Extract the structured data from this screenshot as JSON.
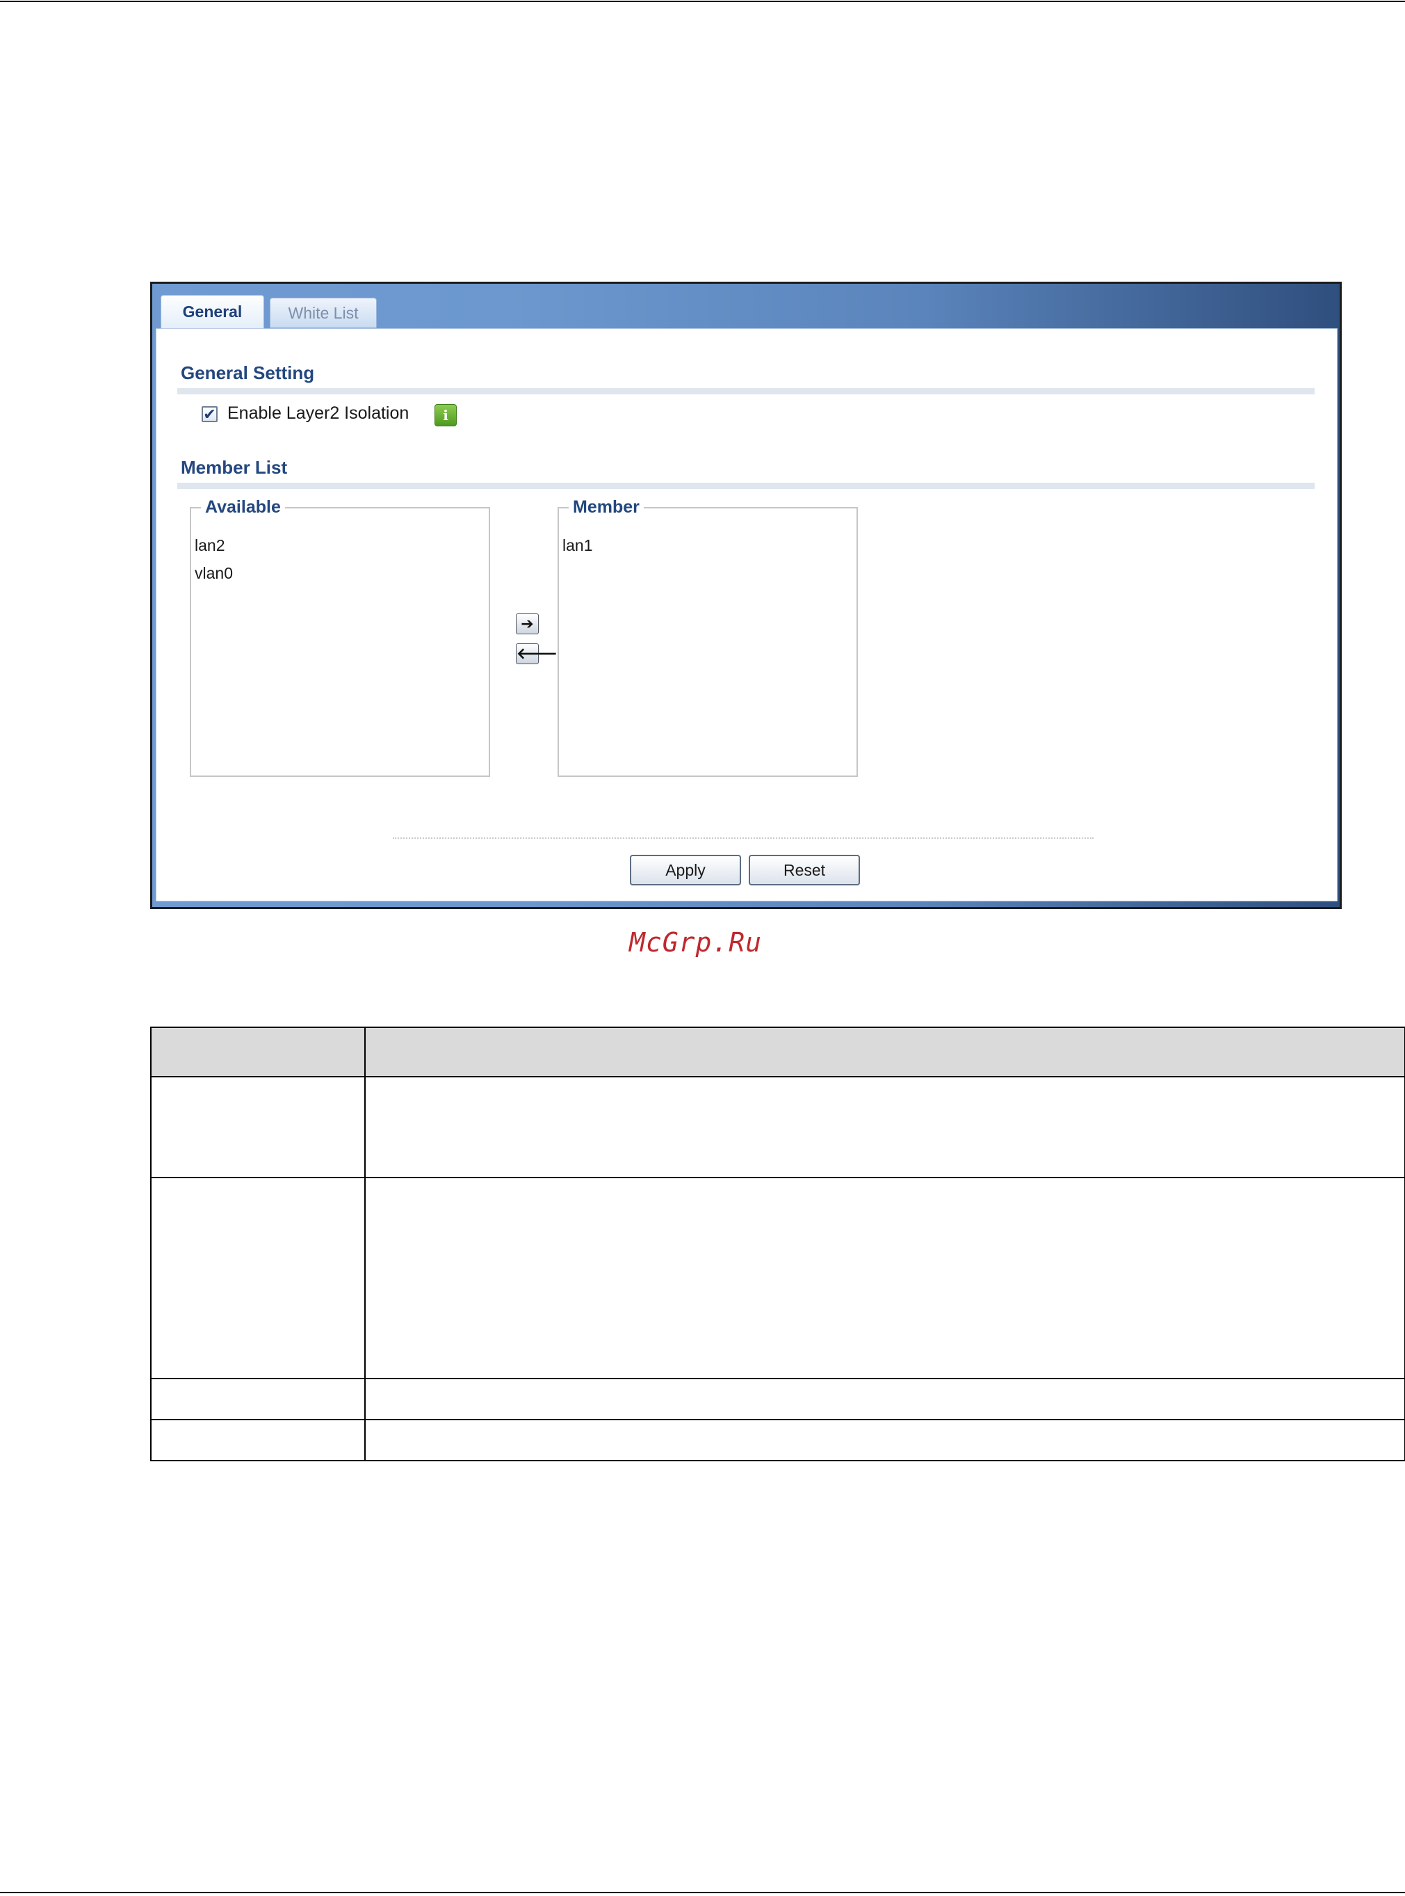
{
  "tabs": [
    {
      "label": "General",
      "active": true
    },
    {
      "label": "White List",
      "active": false
    }
  ],
  "general_setting": {
    "title": "General Setting",
    "enable_checkbox": {
      "label": "Enable Layer2 Isolation",
      "checked": true,
      "check_glyph": "✔"
    },
    "info_icon": {
      "glyph": "i",
      "color": "#5ea52a"
    }
  },
  "member_list": {
    "title": "Member List",
    "available": {
      "legend": "Available",
      "items": [
        "lan2",
        "vlan0"
      ]
    },
    "member": {
      "legend": "Member",
      "items": [
        "lan1"
      ]
    },
    "move_right_glyph": "➔",
    "move_left_glyph": "🡐"
  },
  "buttons": {
    "apply": "Apply",
    "reset": "Reset"
  },
  "watermark": "McGrp.Ru",
  "table": {
    "header": [
      "",
      ""
    ],
    "rows": [
      [
        "",
        ""
      ],
      [
        "",
        ""
      ],
      [
        "",
        ""
      ],
      [
        "",
        ""
      ]
    ]
  },
  "colors": {
    "accent_title": "#23477f",
    "tab_bar_gradient_start": "#6f9bd2",
    "tab_bar_gradient_end": "#2f4f7e",
    "watermark": "#c0282d",
    "table_header_bg": "#dadada"
  }
}
